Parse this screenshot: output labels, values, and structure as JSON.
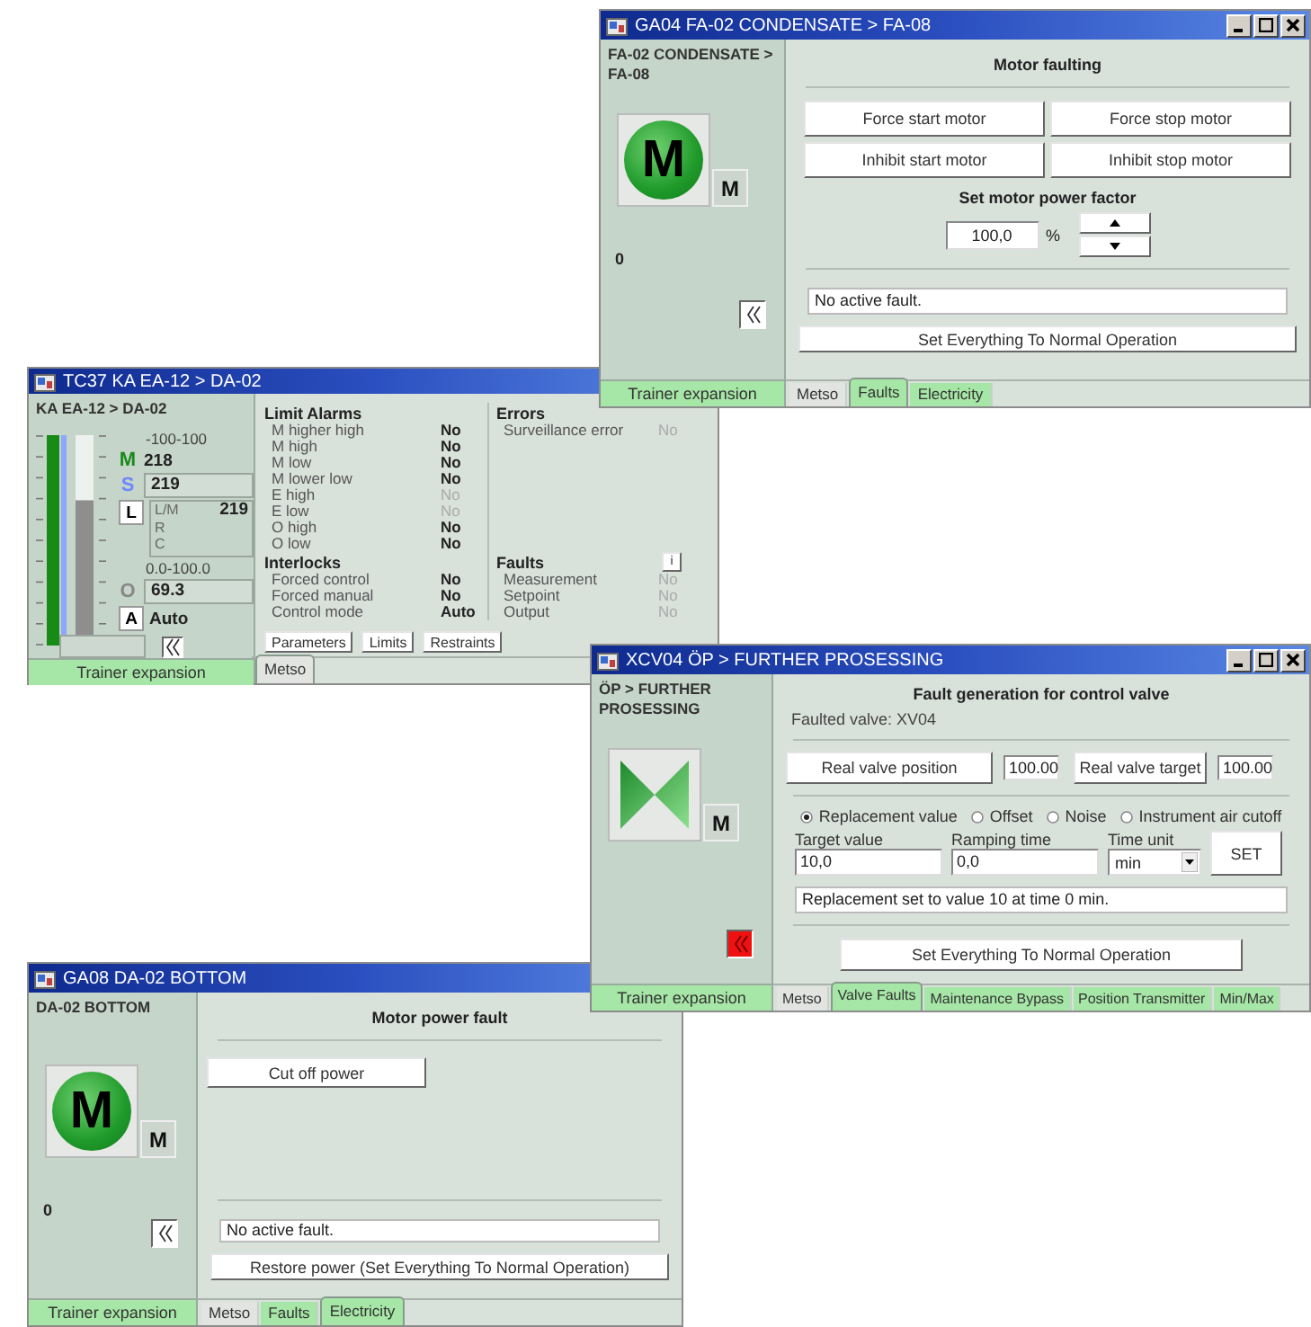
{
  "windows": [
    {
      "title": "GA04 FA-02 CONDENSATE > FA-08",
      "window_buttons": true,
      "side": {
        "kind": "motor",
        "header": "FA-02 CONDENSATE > FA-08",
        "symbol": "M",
        "mode": "M",
        "value": "0",
        "collapse_alert": false,
        "footer": "Trainer expansion"
      },
      "panel": {
        "kind": "motor_faulting",
        "heading": "Motor faulting",
        "buttons": [
          "Force start motor",
          "Force stop motor",
          "Inhibit start motor",
          "Inhibit stop motor"
        ],
        "factor_label": "Set motor power factor",
        "factor_value": "100,0",
        "factor_unit": "%",
        "status": "No active fault.",
        "reset_button": "Set Everything To Normal Operation"
      },
      "tabs": [
        {
          "label": "Metso",
          "selected": false,
          "color": "#e2e4e2"
        },
        {
          "label": "Faults",
          "selected": true,
          "color": "#a6e6a6"
        },
        {
          "label": "Electricity",
          "selected": false,
          "color": "#a6e6a6"
        }
      ]
    },
    {
      "title": "TC37 KA EA-12 > DA-02",
      "side": {
        "kind": "controller",
        "header": "KA EA-12 > DA-02",
        "bars": [
          {
            "color": "#168c16",
            "level": 1
          },
          {
            "color": "#8fa6ff",
            "level": 1
          },
          {
            "color": "#8e8e8e",
            "level": 0.69
          }
        ],
        "range": "-100-100",
        "measurement_tag": "M",
        "measurement": "218",
        "setpoint_tag": "S",
        "setpoint": "219",
        "local_button": "L",
        "local_rows": [
          {
            "label": "L/M",
            "value": "219"
          },
          {
            "label": "R"
          },
          {
            "label": "C"
          }
        ],
        "output_range": "0.0-100.0",
        "output_tag": "O",
        "output": "69.3",
        "auto_button": "A",
        "mode": "Auto",
        "collapse_alert": false,
        "footer": "Trainer expansion"
      },
      "panel": {
        "kind": "controller",
        "sections": [
          {
            "heading": "Limit Alarms",
            "rows": [
              {
                "label": "M higher high",
                "value": "No",
                "disabled": false
              },
              {
                "label": "M high",
                "value": "No",
                "disabled": false
              },
              {
                "label": "M low",
                "value": "No",
                "disabled": false
              },
              {
                "label": "M lower low",
                "value": "No",
                "disabled": false
              },
              {
                "label": "E high",
                "value": "No",
                "disabled": true
              },
              {
                "label": "E low",
                "value": "No",
                "disabled": true
              },
              {
                "label": "O high",
                "value": "No",
                "disabled": false
              },
              {
                "label": "O low",
                "value": "No",
                "disabled": false
              }
            ]
          },
          {
            "heading": "Errors",
            "rows": [
              {
                "label": "Surveillance error",
                "value": "No",
                "disabled": true
              }
            ]
          },
          {
            "heading": "Interlocks",
            "rows": [
              {
                "label": "Forced control",
                "value": "No",
                "disabled": false
              },
              {
                "label": "Forced manual",
                "value": "No",
                "disabled": false
              },
              {
                "label": "Control mode",
                "value": "Auto",
                "disabled": false
              }
            ]
          },
          {
            "heading": "Faults",
            "info_button": "i",
            "rows": [
              {
                "label": "Measurement",
                "value": "No",
                "disabled": true
              },
              {
                "label": "Setpoint",
                "value": "No",
                "disabled": true
              },
              {
                "label": "Output",
                "value": "No",
                "disabled": true
              }
            ]
          }
        ],
        "buttons": [
          "Parameters",
          "Limits",
          "Restraints"
        ]
      },
      "tabs": [
        {
          "label": "Metso",
          "selected": true,
          "color": "#e2e4e2"
        }
      ]
    },
    {
      "title": "XCV04 ÖP > FURTHER PROSESSING",
      "window_buttons": true,
      "side": {
        "kind": "valve",
        "header": "ÖP > FURTHER PROSESSING",
        "mode": "M",
        "collapse_alert": true,
        "footer": "Trainer expansion"
      },
      "panel": {
        "kind": "valve_faults",
        "heading": "Fault generation for control valve",
        "faulted_valve": "Faulted valve: XV04",
        "readings": [
          {
            "button": "Real valve position",
            "value": "100.00"
          },
          {
            "button": "Real valve target",
            "value": "100.00"
          }
        ],
        "fault_types": [
          {
            "label": "Replacement value",
            "selected": true
          },
          {
            "label": "Offset",
            "selected": false
          },
          {
            "label": "Noise",
            "selected": false
          },
          {
            "label": "Instrument air cutoff",
            "selected": false
          }
        ],
        "fields": [
          {
            "kind": "text",
            "label": "Target value",
            "value": "10,0"
          },
          {
            "kind": "text",
            "label": "Ramping time",
            "value": "0,0"
          },
          {
            "kind": "select",
            "label": "Time unit",
            "value": "min"
          }
        ],
        "set_button": "SET",
        "status": "Replacement set to value 10 at time 0 min.",
        "reset_button": "Set Everything To Normal Operation"
      },
      "tabs": [
        {
          "label": "Metso",
          "selected": false,
          "color": "#e2e4e2"
        },
        {
          "label": "Valve Faults",
          "selected": true,
          "color": "#a6e6a6"
        },
        {
          "label": "Maintenance Bypass",
          "selected": false,
          "color": "#a6e6a6"
        },
        {
          "label": "Position Transmitter",
          "selected": false,
          "color": "#a6e6a6"
        },
        {
          "label": "Min/Max",
          "selected": false,
          "color": "#a6e6a6"
        }
      ]
    },
    {
      "title": "GA08 DA-02 BOTTOM",
      "side": {
        "kind": "motor",
        "header": "DA-02 BOTTOM",
        "symbol": "M",
        "mode": "M",
        "value": "0",
        "collapse_alert": false,
        "footer": "Trainer expansion"
      },
      "panel": {
        "kind": "power_fault",
        "heading": "Motor power fault",
        "buttons": [
          "Cut off power"
        ],
        "status": "No active fault.",
        "reset_button": "Restore power (Set Everything To Normal Operation)"
      },
      "tabs": [
        {
          "label": "Metso",
          "selected": false,
          "color": "#e2e4e2"
        },
        {
          "label": "Faults",
          "selected": false,
          "color": "#a6e6a6"
        },
        {
          "label": "Electricity",
          "selected": true,
          "color": "#a6e6a6"
        }
      ]
    }
  ]
}
